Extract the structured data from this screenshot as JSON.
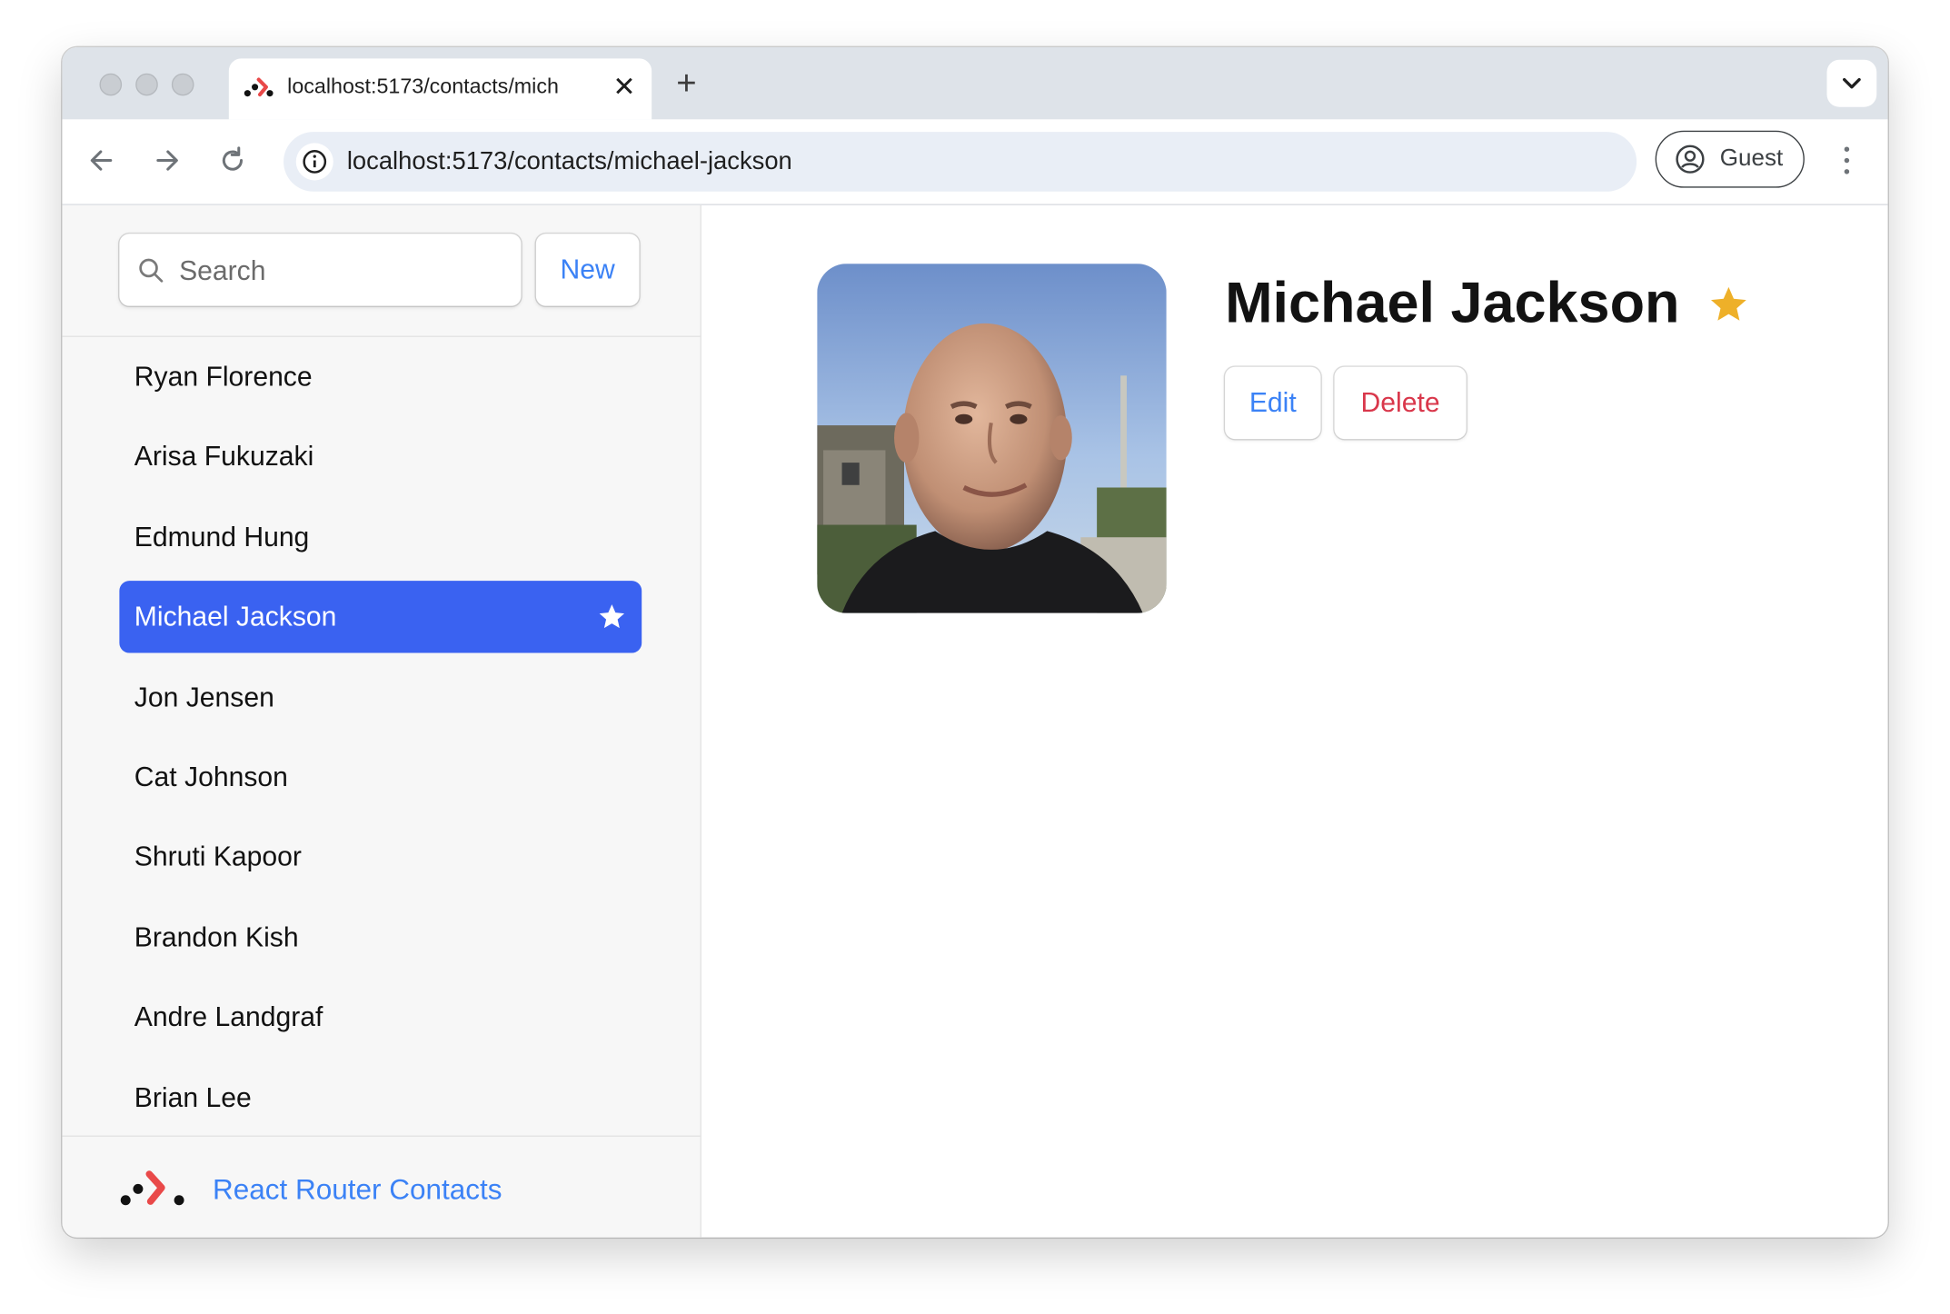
{
  "browser": {
    "tab_title": "localhost:5173/contacts/mich",
    "url": "localhost:5173/contacts/michael-jackson",
    "profile_label": "Guest",
    "icons": {
      "back": "arrow-left-icon",
      "forward": "arrow-right-icon",
      "reload": "reload-icon",
      "site_info": "info-icon",
      "profile": "account-circle-icon",
      "menu": "kebab-menu-icon",
      "tab_close": "close-icon",
      "new_tab": "plus-icon",
      "tab_list": "chevron-down-icon"
    }
  },
  "sidebar": {
    "search_placeholder": "Search",
    "new_label": "New",
    "contacts": [
      {
        "name": "Ryan Florence",
        "active": false,
        "favorite": false
      },
      {
        "name": "Arisa Fukuzaki",
        "active": false,
        "favorite": false
      },
      {
        "name": "Edmund Hung",
        "active": false,
        "favorite": false
      },
      {
        "name": "Michael Jackson",
        "active": true,
        "favorite": true
      },
      {
        "name": "Jon Jensen",
        "active": false,
        "favorite": false
      },
      {
        "name": "Cat Johnson",
        "active": false,
        "favorite": false
      },
      {
        "name": "Shruti Kapoor",
        "active": false,
        "favorite": false
      },
      {
        "name": "Brandon Kish",
        "active": false,
        "favorite": false
      },
      {
        "name": "Andre Landgraf",
        "active": false,
        "favorite": false
      },
      {
        "name": "Brian Lee",
        "active": false,
        "favorite": false
      }
    ],
    "footer_title": "React Router Contacts"
  },
  "detail": {
    "name": "Michael Jackson",
    "favorite": true,
    "edit_label": "Edit",
    "delete_label": "Delete"
  },
  "colors": {
    "accent": "#3b82f6",
    "active_row": "#3a62f1",
    "danger": "#d9374b",
    "favorite_star": "#eeb029"
  }
}
